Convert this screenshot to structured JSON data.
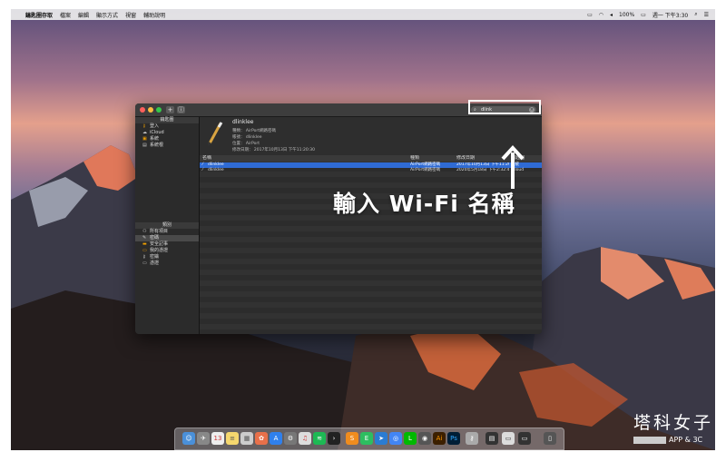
{
  "menubar": {
    "apple": "",
    "app": "鑰匙圈存取",
    "items": [
      "檔案",
      "編輯",
      "顯示方式",
      "視窗",
      "輔助說明"
    ],
    "status": {
      "battery": "100%",
      "time": "週一 下午3:30"
    }
  },
  "window": {
    "search_value": "dlink",
    "sidebar": {
      "keychains_header": "鑰匙圈",
      "keychains": [
        {
          "icon": "key-icon",
          "label": "登入"
        },
        {
          "icon": "cloud-icon",
          "label": "iCloud"
        },
        {
          "icon": "lock-icon",
          "label": "系統"
        },
        {
          "icon": "cabinet-icon",
          "label": "系統根"
        }
      ],
      "categories_header": "類別",
      "categories": [
        {
          "icon": "all-items-icon",
          "label": "所有項目"
        },
        {
          "icon": "password-icon",
          "label": "密碼"
        },
        {
          "icon": "secure-note-icon",
          "label": "安全記事"
        },
        {
          "icon": "certificate-icon",
          "label": "我的憑證"
        },
        {
          "icon": "key-icon",
          "label": "密鑰"
        },
        {
          "icon": "certificate-icon",
          "label": "憑證"
        }
      ]
    },
    "detail": {
      "name": "dlinklee",
      "kind": "種類：  AirPort網路密碼",
      "account": "帳號：  dlinklee",
      "where": "位置：  AirPort",
      "modified": "修改日期：  2017年10月13日 下午11:20:30"
    },
    "table": {
      "headers": [
        "名稱",
        "種類",
        "修改日期",
        "鑰匙圈"
      ],
      "rows": [
        {
          "name": "dlinklee",
          "kind": "AirPort網路密碼",
          "date": "2017年10月13日 下午11:20:30",
          "keychain": "系統"
        },
        {
          "name": "dlinklee",
          "kind": "AirPort網路密碼",
          "date": "2020年5月18日 下午2:32:48",
          "keychain": "iCloud"
        }
      ]
    }
  },
  "overlay_text": "輸入 Wi-Fi 名稱",
  "watermark": {
    "title": "塔科女子",
    "sub": "APP & 3C"
  },
  "colors": {
    "selection": "#2f6bd4",
    "highlight_border": "#ffffff"
  }
}
